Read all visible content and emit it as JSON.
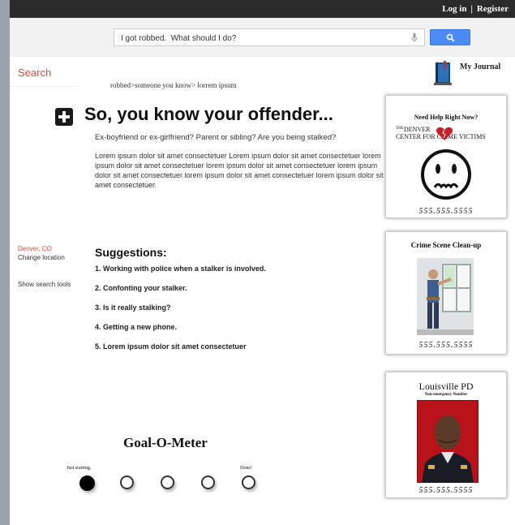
{
  "header": {
    "login": "Log in",
    "separator": "|",
    "register": "Register"
  },
  "search": {
    "query": "I got robbed.  What should I do?"
  },
  "nav": {
    "search_tab": "Search",
    "breadcrumb": "robbed>someone you know> lorrem ipsum"
  },
  "journal": {
    "label": "My Journal"
  },
  "article": {
    "title": "So, you know your offender...",
    "subtitle": "Ex-boyfriend or ex-girlfriend? Parent or sibling? Are you being stalked?",
    "body": "Lorem ipsum dolor sit amet consectetuer  Lorem ipsum dolor sit amet consectetuer lorem ipsum dolor sit amet consectetuer lorem ipsum dolor sit amet consectetuer lorem ipsum dolor sit amet consectetuer lorem ipsum dolor sit amet consectetuer lorem ipsum dolor sit amet consectetuer."
  },
  "sidebar": {
    "location": "Denver, CO",
    "change_location": "Change location",
    "search_tools": "Show search tools"
  },
  "suggestions": {
    "title": "Suggestions:",
    "items": [
      "1. Working with police when a stalker is involved.",
      "2.  Confonting your stalker.",
      "3.  Is it really stalking?",
      "4.  Getting a new phone.",
      "5.  Lorem ipsum dolor sit amet consectetuer"
    ]
  },
  "goal_meter": {
    "title": "Goal-O-Meter",
    "start_label": "Just starting.",
    "end_label": "Done!",
    "steps_total": 5,
    "steps_completed": 1
  },
  "ads": {
    "help": {
      "heading": "Need Help Right Now?",
      "logo_small": "THE",
      "logo_line1": "DENVER",
      "logo_line2": "CENTER FOR CRIME VICTIMS",
      "phone": "555.555.5555"
    },
    "cleanup": {
      "heading": "Crime Scene Clean-up",
      "phone": "555.555.5555"
    },
    "police": {
      "heading": "Louisville PD",
      "subheading": "Non-emergency Number",
      "phone": "555.555.5555"
    }
  },
  "colors": {
    "accent_red": "#dd4b39",
    "search_blue": "#4a8bf5",
    "topbar": "#2b2b2b"
  }
}
